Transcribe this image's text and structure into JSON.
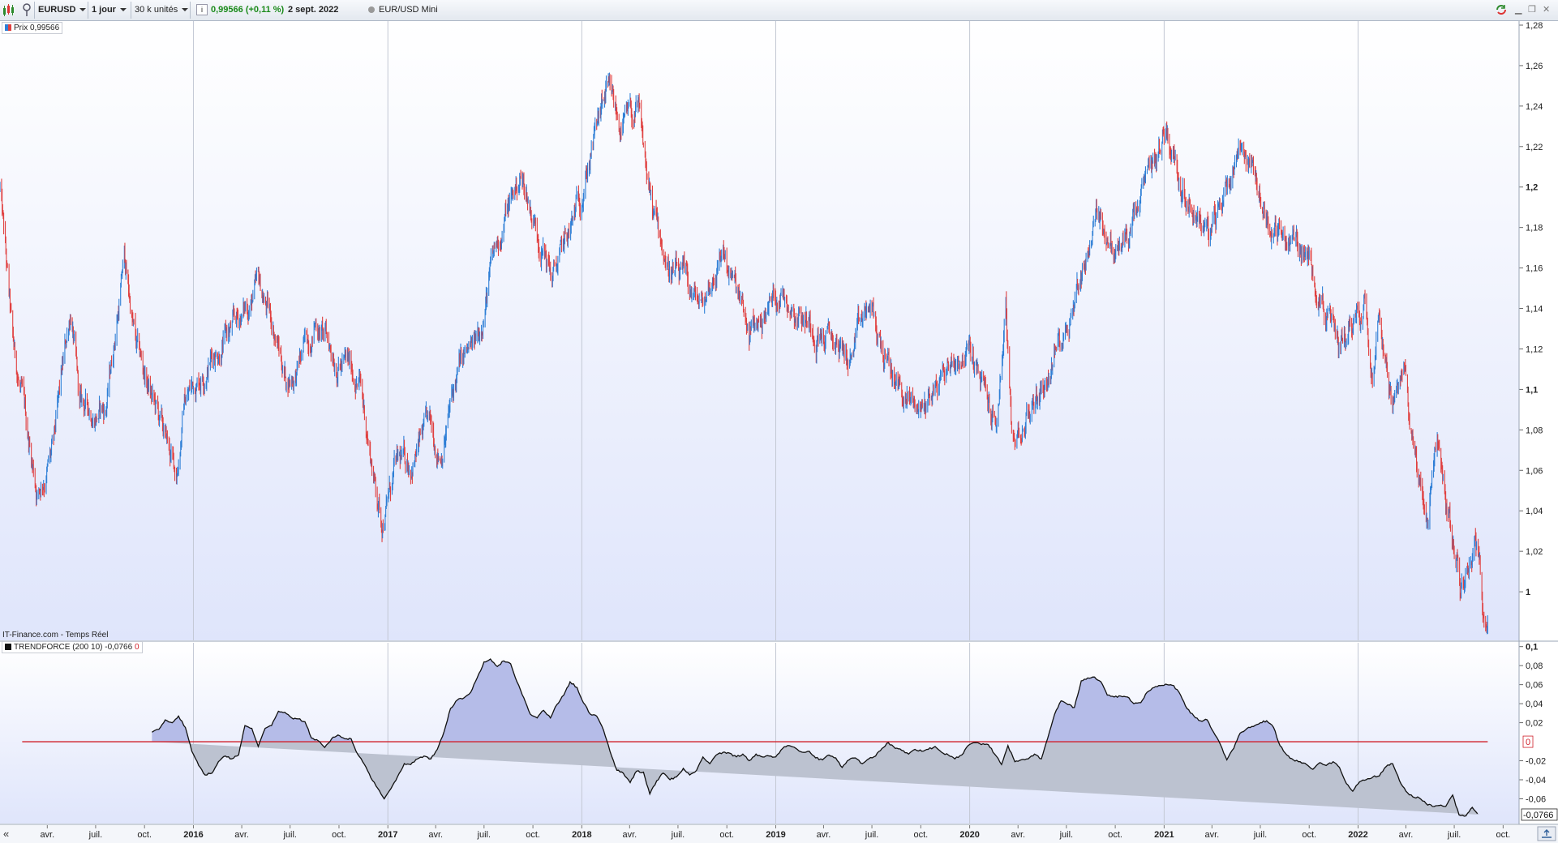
{
  "toolbar": {
    "symbol": "EURUSD",
    "period": "1 jour",
    "size": "30 k unités",
    "price_change": "0,99566 (+0,11 %)",
    "date": "2 sept. 2022",
    "instrument": "EUR/USD Mini",
    "icons": [
      "candlestick-icon",
      "info-icon",
      "refresh-icon",
      "minimize-icon",
      "restore-icon",
      "close-icon"
    ]
  },
  "colors": {
    "price_up": "#2f7fd6",
    "price_down": "#e04040",
    "trend_line": "#111111",
    "zero_line": "#d0202a",
    "fill_positive": "#b5bce8",
    "fill_negative": "#bcc2d0",
    "background_top": "#ffffff",
    "background_bottom": "#e0e6fa",
    "change_text": "#1a8a1a"
  },
  "price_panel": {
    "legend": "Prix 0,99566",
    "source": "IT-Finance.com - Temps Réel"
  },
  "indicator_panel": {
    "legend": "TRENDFORCE (200 10) -0,0766",
    "legend_zero": "0",
    "last_value": "-0,0766",
    "zero_label": "0"
  },
  "chart_data": [
    {
      "type": "line",
      "title": "EURUSD",
      "x": [
        "2015-01-02",
        "2015-01-26",
        "2015-03-13",
        "2015-04-13",
        "2015-05-15",
        "2015-06-01",
        "2015-07-20",
        "2015-08-24",
        "2015-09-15",
        "2015-11-30",
        "2015-12-15",
        "2016-02-10",
        "2016-03-17",
        "2016-05-03",
        "2016-06-01",
        "2016-06-24",
        "2016-07-15",
        "2016-08-18",
        "2016-09-15",
        "2016-11-08",
        "2016-12-01",
        "2016-12-20",
        "2017-01-15",
        "2017-02-15",
        "2017-03-15",
        "2017-04-10",
        "2017-05-15",
        "2017-06-15",
        "2017-07-15",
        "2017-08-15",
        "2017-09-08",
        "2017-10-15",
        "2017-11-07",
        "2017-12-15",
        "2018-01-10",
        "2018-02-16",
        "2018-03-15",
        "2018-04-17",
        "2018-05-15",
        "2018-06-15",
        "2018-08-15",
        "2018-09-24",
        "2018-11-12",
        "2019-01-10",
        "2019-03-20",
        "2019-05-23",
        "2019-06-25",
        "2019-08-01",
        "2019-09-03",
        "2019-10-01",
        "2019-12-01",
        "2019-12-31",
        "2020-02-20",
        "2020-03-09",
        "2020-03-20",
        "2020-04-15",
        "2020-05-31",
        "2020-07-15",
        "2020-08-31",
        "2020-10-01",
        "2020-11-04",
        "2021-01-06",
        "2021-01-31",
        "2021-03-31",
        "2021-05-25",
        "2021-06-15",
        "2021-07-20",
        "2021-08-20",
        "2021-09-15",
        "2021-10-15",
        "2021-11-24",
        "2021-12-15",
        "2022-01-14",
        "2022-01-28",
        "2022-02-10",
        "2022-03-07",
        "2022-03-31",
        "2022-04-28",
        "2022-05-13",
        "2022-05-30",
        "2022-06-15",
        "2022-07-14",
        "2022-08-10",
        "2022-08-23",
        "2022-09-02"
      ],
      "y": [
        1.2,
        1.12,
        1.05,
        1.07,
        1.14,
        1.09,
        1.09,
        1.165,
        1.12,
        1.057,
        1.095,
        1.12,
        1.13,
        1.15,
        1.13,
        1.105,
        1.11,
        1.135,
        1.12,
        1.105,
        1.065,
        1.035,
        1.06,
        1.065,
        1.08,
        1.07,
        1.11,
        1.12,
        1.16,
        1.19,
        1.205,
        1.175,
        1.155,
        1.18,
        1.21,
        1.245,
        1.23,
        1.235,
        1.185,
        1.16,
        1.14,
        1.17,
        1.125,
        1.15,
        1.13,
        1.115,
        1.14,
        1.11,
        1.095,
        1.09,
        1.115,
        1.12,
        1.08,
        1.14,
        1.07,
        1.085,
        1.11,
        1.145,
        1.19,
        1.165,
        1.18,
        1.23,
        1.205,
        1.175,
        1.225,
        1.21,
        1.18,
        1.175,
        1.17,
        1.155,
        1.12,
        1.133,
        1.145,
        1.115,
        1.145,
        1.09,
        1.105,
        1.05,
        1.037,
        1.075,
        1.045,
        1.0,
        1.03,
        0.995,
        0.996
      ],
      "xlim": [
        "2015-01-02",
        "2022-10-31"
      ],
      "ylim": [
        0.976,
        1.282
      ],
      "ytick_labels": [
        "1",
        "1,02",
        "1,04",
        "1,06",
        "1,08",
        "1,1",
        "1,12",
        "1,14",
        "1,16",
        "1,18",
        "1,2",
        "1,22",
        "1,24",
        "1,26",
        "1,28"
      ],
      "ytick_values": [
        1.0,
        1.02,
        1.04,
        1.06,
        1.08,
        1.1,
        1.12,
        1.14,
        1.16,
        1.18,
        1.2,
        1.22,
        1.24,
        1.26,
        1.28
      ],
      "bold_ticks": [
        "1",
        "1,1",
        "1,2"
      ],
      "grid": "vertical-yearly"
    },
    {
      "type": "area",
      "title": "TRENDFORCE (200 10)",
      "x": [
        "2015-10-15",
        "2015-10-28",
        "2015-11-09",
        "2015-11-22",
        "2015-12-04",
        "2015-12-17",
        "2015-12-29",
        "2016-01-11",
        "2016-01-23",
        "2016-02-05",
        "2016-02-17",
        "2016-03-01",
        "2016-03-13",
        "2016-03-26",
        "2016-04-07",
        "2016-04-20",
        "2016-05-02",
        "2016-05-15",
        "2016-05-27",
        "2016-06-09",
        "2016-06-21",
        "2016-07-04",
        "2016-07-16",
        "2016-07-29",
        "2016-08-10",
        "2016-08-23",
        "2016-09-04",
        "2016-09-17",
        "2016-09-29",
        "2016-10-12",
        "2016-10-24",
        "2016-11-05",
        "2016-11-18",
        "2016-11-30",
        "2016-12-13",
        "2016-12-25",
        "2017-01-07",
        "2017-01-19",
        "2017-02-01",
        "2017-02-13",
        "2017-02-26",
        "2017-03-10",
        "2017-03-23",
        "2017-04-04",
        "2017-04-17",
        "2017-04-29",
        "2017-05-12",
        "2017-05-24",
        "2017-06-06",
        "2017-06-18",
        "2017-07-01",
        "2017-07-13",
        "2017-07-26",
        "2017-08-07",
        "2017-08-20",
        "2017-09-01",
        "2017-09-14",
        "2017-09-26",
        "2017-10-09",
        "2017-10-21",
        "2017-11-03",
        "2017-11-15",
        "2017-11-28",
        "2017-12-10",
        "2017-12-23",
        "2018-01-04",
        "2018-01-17",
        "2018-01-29",
        "2018-02-11",
        "2018-02-23",
        "2018-03-08",
        "2018-03-20",
        "2018-04-02",
        "2018-04-14",
        "2018-04-27",
        "2018-05-09",
        "2018-05-22",
        "2018-06-03",
        "2018-06-16",
        "2018-06-28",
        "2018-07-11",
        "2018-07-23",
        "2018-08-05",
        "2018-08-17",
        "2018-08-30",
        "2018-09-11",
        "2018-09-24",
        "2018-10-06",
        "2018-10-19",
        "2018-10-31",
        "2018-11-12",
        "2018-11-25",
        "2018-12-07",
        "2018-12-20",
        "2019-01-01",
        "2019-01-14",
        "2019-01-26",
        "2019-02-08",
        "2019-02-20",
        "2019-03-05",
        "2019-03-17",
        "2019-03-30",
        "2019-04-11",
        "2019-04-24",
        "2019-05-06",
        "2019-05-19",
        "2019-05-31",
        "2019-06-13",
        "2019-06-25",
        "2019-07-08",
        "2019-07-20",
        "2019-08-01",
        "2019-08-14",
        "2019-08-26",
        "2019-09-08",
        "2019-09-20",
        "2019-10-03",
        "2019-10-15",
        "2019-10-28",
        "2019-11-09",
        "2019-11-22",
        "2019-12-04",
        "2019-12-17",
        "2019-12-29",
        "2020-01-11",
        "2020-01-23",
        "2020-02-05",
        "2020-02-17",
        "2020-03-01",
        "2020-03-13",
        "2020-03-26",
        "2020-04-07",
        "2020-04-20",
        "2020-05-02",
        "2020-05-15",
        "2020-05-27",
        "2020-06-09",
        "2020-06-21",
        "2020-07-04",
        "2020-07-16",
        "2020-07-29",
        "2020-08-10",
        "2020-08-23",
        "2020-09-04",
        "2020-09-16",
        "2020-09-29",
        "2020-10-11",
        "2020-10-24",
        "2020-11-05",
        "2020-11-18",
        "2020-11-30",
        "2020-12-13",
        "2020-12-25",
        "2021-01-07",
        "2021-01-19",
        "2021-02-01",
        "2021-02-13",
        "2021-02-26",
        "2021-03-10",
        "2021-03-23",
        "2021-04-04",
        "2021-04-17",
        "2021-04-29",
        "2021-05-12",
        "2021-05-24",
        "2021-06-06",
        "2021-06-18",
        "2021-07-01",
        "2021-07-13",
        "2021-07-26",
        "2021-08-07",
        "2021-08-20",
        "2021-09-01",
        "2021-09-14",
        "2021-09-26",
        "2021-10-08",
        "2021-10-21",
        "2021-11-02",
        "2021-11-15",
        "2021-11-27",
        "2021-12-10",
        "2021-12-22",
        "2022-01-04",
        "2022-01-16",
        "2022-01-29",
        "2022-02-10",
        "2022-02-23",
        "2022-03-07",
        "2022-03-20",
        "2022-04-01",
        "2022-04-14",
        "2022-04-26",
        "2022-05-09",
        "2022-05-21",
        "2022-06-03",
        "2022-06-15",
        "2022-06-28",
        "2022-07-10",
        "2022-07-23",
        "2022-08-04",
        "2022-08-17",
        "2022-08-29",
        "2022-09-02"
      ],
      "y": [
        0.01,
        0.013,
        0.023,
        0.02,
        0.027,
        0.015,
        -0.01,
        -0.025,
        -0.035,
        -0.033,
        -0.021,
        -0.015,
        -0.018,
        -0.014,
        0.017,
        0.014,
        -0.005,
        0.014,
        0.017,
        0.032,
        0.031,
        0.025,
        0.024,
        0.021,
        0.004,
        0.001,
        -0.006,
        0.003,
        0.007,
        0.003,
        0.003,
        -0.013,
        -0.024,
        -0.038,
        -0.049,
        -0.06,
        -0.049,
        -0.037,
        -0.023,
        -0.024,
        -0.018,
        -0.015,
        -0.018,
        -0.008,
        0.011,
        0.035,
        0.044,
        0.046,
        0.052,
        0.067,
        0.084,
        0.087,
        0.079,
        0.085,
        0.082,
        0.063,
        0.046,
        0.029,
        0.025,
        0.033,
        0.025,
        0.039,
        0.049,
        0.063,
        0.057,
        0.041,
        0.029,
        0.027,
        0.012,
        -0.01,
        -0.03,
        -0.033,
        -0.043,
        -0.031,
        -0.032,
        -0.055,
        -0.041,
        -0.033,
        -0.04,
        -0.037,
        -0.028,
        -0.035,
        -0.03,
        -0.016,
        -0.023,
        -0.014,
        -0.011,
        -0.012,
        -0.016,
        -0.013,
        -0.02,
        -0.013,
        -0.016,
        -0.015,
        -0.016,
        -0.007,
        -0.004,
        -0.007,
        -0.011,
        -0.01,
        -0.017,
        -0.019,
        -0.014,
        -0.017,
        -0.027,
        -0.019,
        -0.017,
        -0.023,
        -0.018,
        -0.015,
        -0.007,
        -0.001,
        -0.007,
        -0.009,
        -0.013,
        -0.008,
        -0.01,
        -0.008,
        -0.005,
        -0.011,
        -0.014,
        -0.018,
        -0.014,
        -0.004,
        -0.001,
        -0.003,
        -0.003,
        -0.013,
        -0.024,
        -0.004,
        -0.021,
        -0.019,
        -0.018,
        -0.013,
        -0.018,
        0.004,
        0.029,
        0.043,
        0.039,
        0.036,
        0.064,
        0.067,
        0.068,
        0.063,
        0.049,
        0.047,
        0.048,
        0.047,
        0.04,
        0.041,
        0.052,
        0.057,
        0.059,
        0.06,
        0.059,
        0.049,
        0.035,
        0.027,
        0.022,
        0.023,
        0.01,
        -0.003,
        -0.019,
        -0.007,
        0.009,
        0.014,
        0.016,
        0.02,
        0.022,
        0.015,
        -0.004,
        -0.014,
        -0.019,
        -0.021,
        -0.024,
        -0.029,
        -0.022,
        -0.025,
        -0.021,
        -0.027,
        -0.044,
        -0.052,
        -0.042,
        -0.04,
        -0.037,
        -0.036,
        -0.026,
        -0.023,
        -0.041,
        -0.052,
        -0.058,
        -0.059,
        -0.065,
        -0.068,
        -0.067,
        -0.068,
        -0.056,
        -0.077,
        -0.078,
        -0.069,
        -0.0766
      ],
      "xlim": [
        "2015-01-02",
        "2022-10-31"
      ],
      "ylim": [
        -0.086,
        0.104
      ],
      "ytick_labels": [
        "-0,06",
        "-0,04",
        "-0,02",
        "0,02",
        "0,04",
        "0,06",
        "0,08",
        "0,1"
      ],
      "ytick_values": [
        -0.06,
        -0.04,
        -0.02,
        0.02,
        0.04,
        0.06,
        0.08,
        0.1
      ],
      "bold_ticks": [
        "0,1"
      ],
      "reference_line": 0
    }
  ],
  "x_axis": {
    "ticks": [
      {
        "label": "avr.",
        "date": "2015-04-01",
        "bold": false
      },
      {
        "label": "juil.",
        "date": "2015-07-01",
        "bold": false
      },
      {
        "label": "oct.",
        "date": "2015-10-01",
        "bold": false
      },
      {
        "label": "2016",
        "date": "2016-01-01",
        "bold": true
      },
      {
        "label": "avr.",
        "date": "2016-04-01",
        "bold": false
      },
      {
        "label": "juil.",
        "date": "2016-07-01",
        "bold": false
      },
      {
        "label": "oct.",
        "date": "2016-10-01",
        "bold": false
      },
      {
        "label": "2017",
        "date": "2017-01-01",
        "bold": true
      },
      {
        "label": "avr.",
        "date": "2017-04-01",
        "bold": false
      },
      {
        "label": "juil.",
        "date": "2017-07-01",
        "bold": false
      },
      {
        "label": "oct.",
        "date": "2017-10-01",
        "bold": false
      },
      {
        "label": "2018",
        "date": "2018-01-01",
        "bold": true
      },
      {
        "label": "avr.",
        "date": "2018-04-01",
        "bold": false
      },
      {
        "label": "juil.",
        "date": "2018-07-01",
        "bold": false
      },
      {
        "label": "oct.",
        "date": "2018-10-01",
        "bold": false
      },
      {
        "label": "2019",
        "date": "2019-01-01",
        "bold": true
      },
      {
        "label": "avr.",
        "date": "2019-04-01",
        "bold": false
      },
      {
        "label": "juil.",
        "date": "2019-07-01",
        "bold": false
      },
      {
        "label": "oct.",
        "date": "2019-10-01",
        "bold": false
      },
      {
        "label": "2020",
        "date": "2020-01-01",
        "bold": true
      },
      {
        "label": "avr.",
        "date": "2020-04-01",
        "bold": false
      },
      {
        "label": "juil.",
        "date": "2020-07-01",
        "bold": false
      },
      {
        "label": "oct.",
        "date": "2020-10-01",
        "bold": false
      },
      {
        "label": "2021",
        "date": "2021-01-01",
        "bold": true
      },
      {
        "label": "avr.",
        "date": "2021-04-01",
        "bold": false
      },
      {
        "label": "juil.",
        "date": "2021-07-01",
        "bold": false
      },
      {
        "label": "oct.",
        "date": "2021-10-01",
        "bold": false
      },
      {
        "label": "2022",
        "date": "2022-01-01",
        "bold": true
      },
      {
        "label": "avr.",
        "date": "2022-04-01",
        "bold": false
      },
      {
        "label": "juil.",
        "date": "2022-07-01",
        "bold": false
      },
      {
        "label": "oct.",
        "date": "2022-10-01",
        "bold": false
      }
    ],
    "scroll_left": "«"
  }
}
